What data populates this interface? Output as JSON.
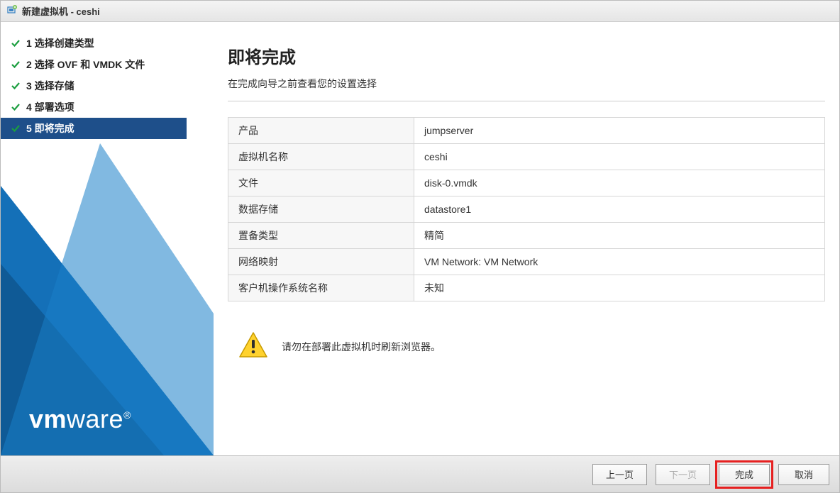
{
  "titlebar": {
    "title": "新建虚拟机 - ceshi"
  },
  "steps": [
    {
      "label": "1 选择创建类型",
      "done": true,
      "active": false
    },
    {
      "label": "2 选择 OVF 和 VMDK 文件",
      "done": true,
      "active": false
    },
    {
      "label": "3 选择存储",
      "done": true,
      "active": false
    },
    {
      "label": "4 部署选项",
      "done": true,
      "active": false
    },
    {
      "label": "5 即将完成",
      "done": true,
      "active": true
    }
  ],
  "main": {
    "heading": "即将完成",
    "subtitle": "在完成向导之前查看您的设置选择"
  },
  "summary": [
    {
      "key": "产品",
      "value": "jumpserver"
    },
    {
      "key": "虚拟机名称",
      "value": "ceshi"
    },
    {
      "key": "文件",
      "value": "disk-0.vmdk"
    },
    {
      "key": "数据存储",
      "value": "datastore1"
    },
    {
      "key": "置备类型",
      "value": "精简"
    },
    {
      "key": "网络映射",
      "value": "VM Network: VM Network"
    },
    {
      "key": "客户机操作系统名称",
      "value": "未知"
    }
  ],
  "warning": "请勿在部署此虚拟机时刷新浏览器。",
  "footer": {
    "back": "上一页",
    "next": "下一页",
    "finish": "完成",
    "cancel": "取消"
  },
  "brand": "vmware"
}
